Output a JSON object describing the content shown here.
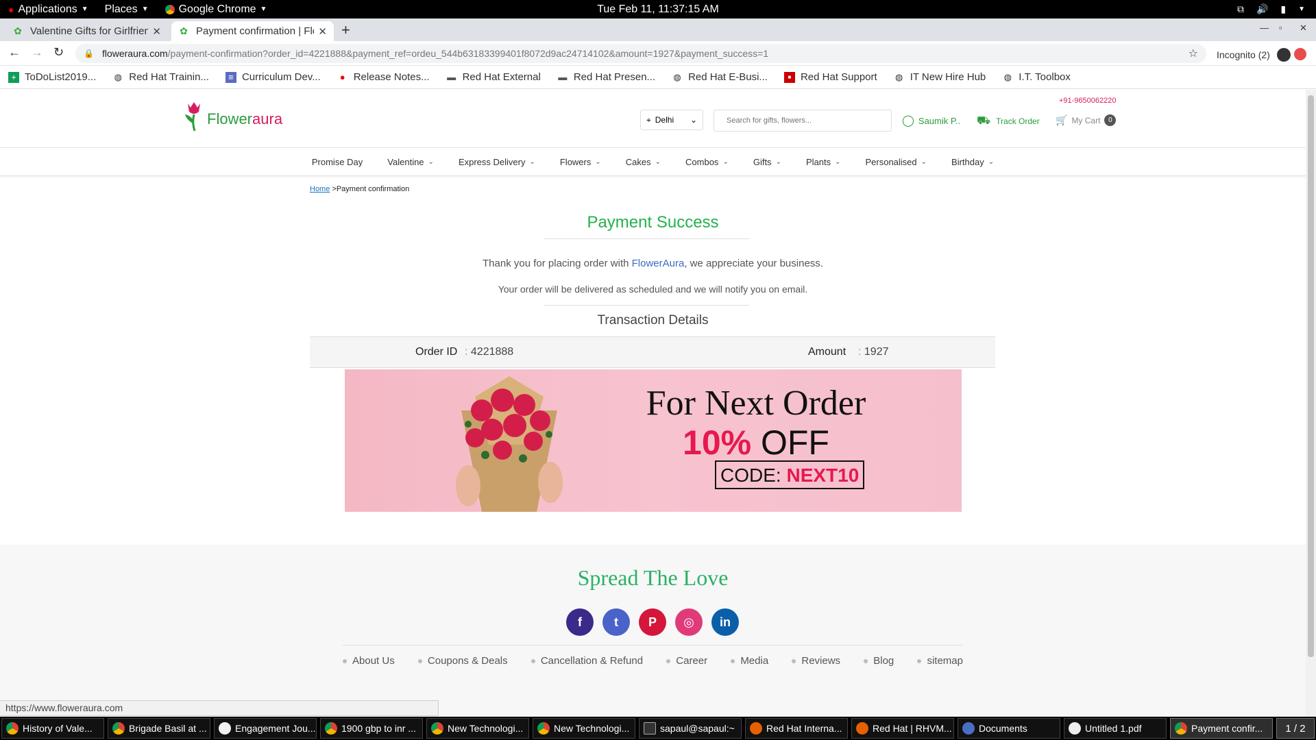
{
  "topbar": {
    "applications": "Applications",
    "places": "Places",
    "chrome": "Google Chrome",
    "datetime": "Tue Feb 11, 11:37:15 AM"
  },
  "tabs": [
    {
      "title": "Valentine Gifts for Girlfrien",
      "active": false
    },
    {
      "title": "Payment confirmation | Flo",
      "active": true
    }
  ],
  "address": {
    "host": "floweraura.com",
    "path": "/payment-confirmation?order_id=4221888&payment_ref=ordeu_544b63183399401f8072d9ac24714102&amount=1927&payment_success=1",
    "incognito": "Incognito (2)"
  },
  "bookmarks": [
    {
      "label": "ToDoList2019...",
      "icon": "sheet-icon"
    },
    {
      "label": "Red Hat Trainin...",
      "icon": "globe-icon"
    },
    {
      "label": "Curriculum Dev...",
      "icon": "doc-icon"
    },
    {
      "label": "Release Notes...",
      "icon": "redhat-icon"
    },
    {
      "label": "Red Hat External",
      "icon": "folder-icon"
    },
    {
      "label": "Red Hat Presen...",
      "icon": "folder-icon"
    },
    {
      "label": "Red Hat E-Busi...",
      "icon": "globe-icon"
    },
    {
      "label": "Red Hat Support",
      "icon": "redhat-icon"
    },
    {
      "label": "IT New Hire Hub",
      "icon": "globe-icon"
    },
    {
      "label": "I.T. Toolbox",
      "icon": "globe-icon"
    }
  ],
  "site": {
    "logo_flower": "Flower",
    "logo_aura": "aura",
    "phone": "+91-9650062220",
    "city": "Delhi",
    "search_placeholder": "Search for gifts, flowers...",
    "account": "Saumik P..",
    "track_order": "Track Order",
    "cart_label": "My Cart",
    "cart_count": "0",
    "menu": [
      {
        "label": "Promise Day",
        "dropdown": false
      },
      {
        "label": "Valentine",
        "dropdown": true
      },
      {
        "label": "Express Delivery",
        "dropdown": true
      },
      {
        "label": "Flowers",
        "dropdown": true
      },
      {
        "label": "Cakes",
        "dropdown": true
      },
      {
        "label": "Combos",
        "dropdown": true
      },
      {
        "label": "Gifts",
        "dropdown": true
      },
      {
        "label": "Plants",
        "dropdown": true
      },
      {
        "label": "Personalised",
        "dropdown": true
      },
      {
        "label": "Birthday",
        "dropdown": true
      }
    ]
  },
  "breadcrumb": {
    "home": "Home",
    "separator": ">",
    "current": "Payment confirmation"
  },
  "payment": {
    "title": "Payment Success",
    "thanks_pre": "Thank you for placing order with ",
    "thanks_brand": "FlowerAura",
    "thanks_post": ", we appreciate your business.",
    "notify": "Your order will be delivered as scheduled and we will notify you on email.",
    "transaction_title": "Transaction Details",
    "order_id_label": "Order ID",
    "order_id": "4221888",
    "amount_label": "Amount",
    "amount": "1927",
    "colon": ":"
  },
  "promo": {
    "headline": "For Next Order",
    "percent": "10%",
    "off": "OFF",
    "code_label": "CODE:",
    "code": "NEXT10"
  },
  "footer": {
    "spread": "Spread The Love",
    "social": [
      {
        "name": "facebook-icon",
        "glyph": "f",
        "color": "#3b2a8a"
      },
      {
        "name": "twitter-icon",
        "glyph": "t",
        "color": "#4a63c8"
      },
      {
        "name": "pinterest-icon",
        "glyph": "P",
        "color": "#d4163b"
      },
      {
        "name": "instagram-icon",
        "glyph": "◎",
        "color": "#e03a7a"
      },
      {
        "name": "linkedin-icon",
        "glyph": "in",
        "color": "#0b5fa8"
      }
    ],
    "links": [
      "About Us",
      "Coupons & Deals",
      "Cancellation & Refund",
      "Career",
      "Media",
      "Reviews",
      "Blog",
      "sitemap"
    ]
  },
  "status_url": "https://www.floweraura.com",
  "taskbar": [
    {
      "label": "History of Vale...",
      "icon": "chrome-icon",
      "active": false
    },
    {
      "label": "Brigade Basil at ...",
      "icon": "chrome-icon",
      "active": false
    },
    {
      "label": "Engagement Jou...",
      "icon": "app-icon",
      "active": false
    },
    {
      "label": "1900 gbp to inr ...",
      "icon": "chrome-icon",
      "active": false
    },
    {
      "label": "New Technologi...",
      "icon": "chrome-icon",
      "active": false
    },
    {
      "label": "New Technologi...",
      "icon": "chrome-icon",
      "active": false
    },
    {
      "label": "sapaul@sapaul:~",
      "icon": "terminal-icon",
      "active": false
    },
    {
      "label": "Red Hat Interna...",
      "icon": "firefox-icon",
      "active": false
    },
    {
      "label": "Red Hat | RHVM...",
      "icon": "firefox-icon",
      "active": false
    },
    {
      "label": "Documents",
      "icon": "files-icon",
      "active": false
    },
    {
      "label": "Untitled 1.pdf",
      "icon": "pdf-icon",
      "active": false
    },
    {
      "label": "Payment confir...",
      "icon": "chrome-icon",
      "active": true
    }
  ],
  "workspace": "1 / 2",
  "colors": {
    "brand_green": "#2b9c3d",
    "success_green": "#22b24c",
    "brand_pink": "#d81b60",
    "promo_red": "#e6194f"
  }
}
